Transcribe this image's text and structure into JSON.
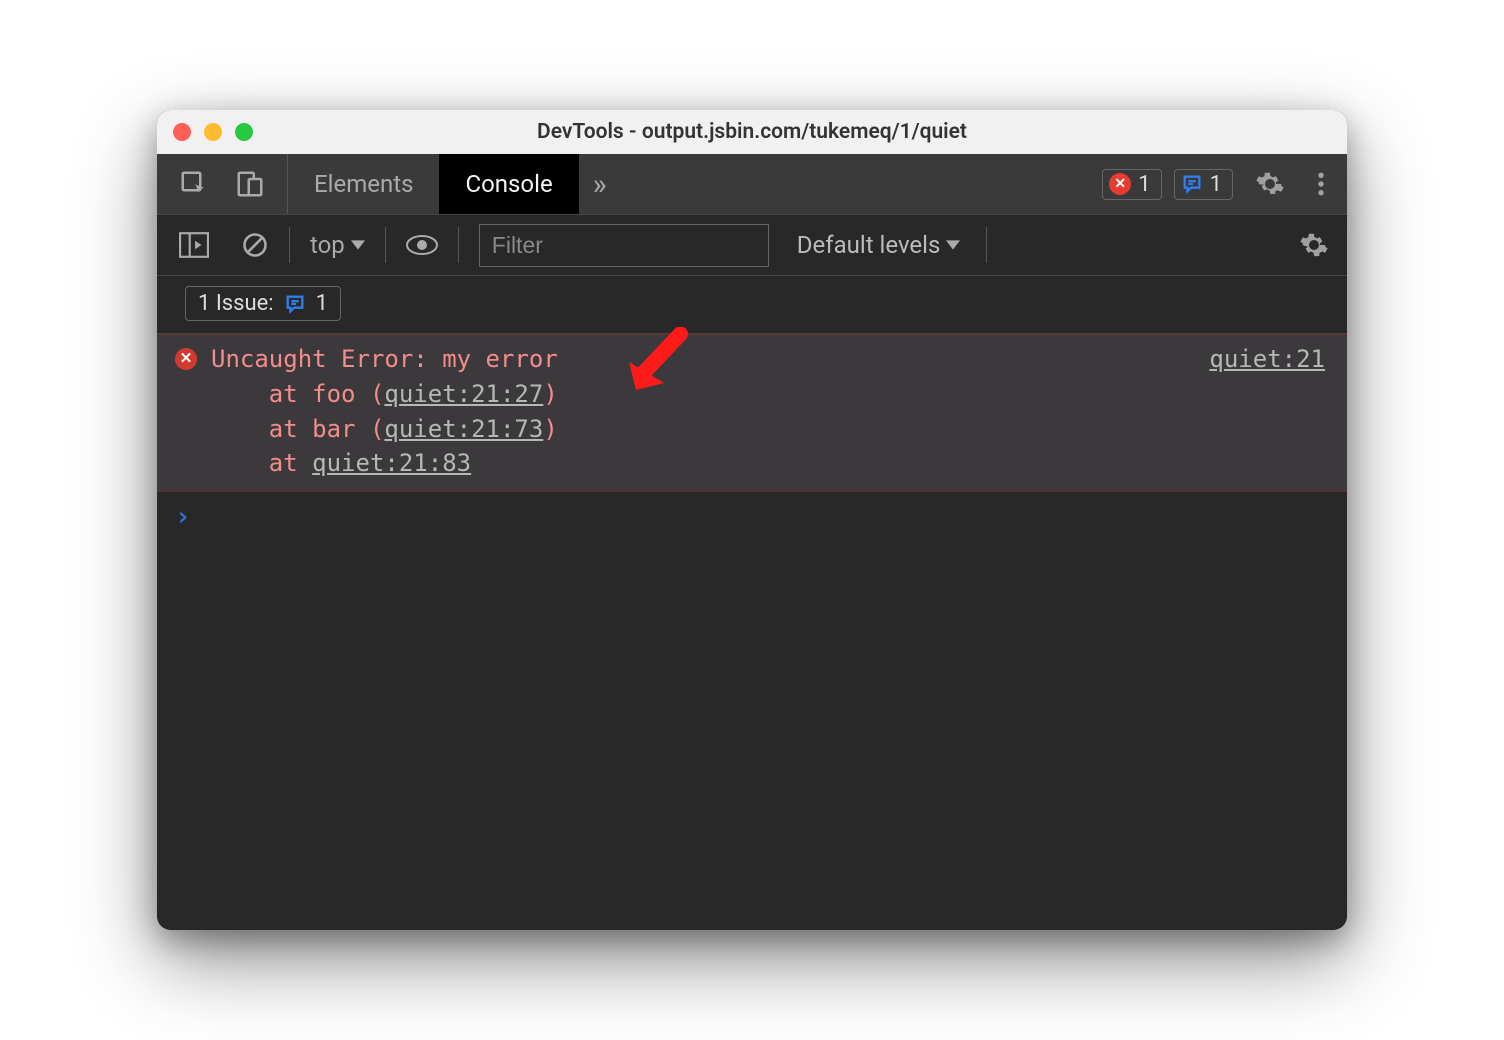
{
  "window": {
    "title": "DevTools - output.jsbin.com/tukemeq/1/quiet"
  },
  "tabs": {
    "elements": "Elements",
    "console": "Console",
    "overflow": "»"
  },
  "badges": {
    "error_count": "1",
    "issue_count": "1"
  },
  "toolbar": {
    "context": "top",
    "filter_placeholder": "Filter",
    "levels_label": "Default levels"
  },
  "issues": {
    "label": "1 Issue:",
    "count": "1"
  },
  "error": {
    "message": "Uncaught Error: my error",
    "source_link": "quiet:21",
    "stack": [
      {
        "prefix": "    at foo (",
        "link": "quiet:21:27",
        "suffix": ")"
      },
      {
        "prefix": "    at bar (",
        "link": "quiet:21:73",
        "suffix": ")"
      },
      {
        "prefix": "    at ",
        "link": "quiet:21:83",
        "suffix": ""
      }
    ]
  },
  "prompt": "›"
}
